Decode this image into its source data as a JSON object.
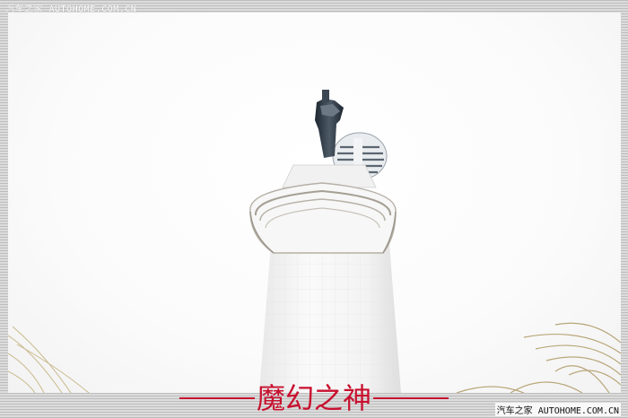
{
  "image": {
    "watermark_top": "汽车之家 AUTOHOME.COM.CN",
    "watermark_bottom": "汽车之家 AUTOHOME.COM.CN",
    "caption": "魔幻之神",
    "colors": {
      "caption": "#c8102e",
      "border": "#c9c9c9",
      "tower": "#f6f6f6",
      "statue": "#2f3a45"
    }
  }
}
